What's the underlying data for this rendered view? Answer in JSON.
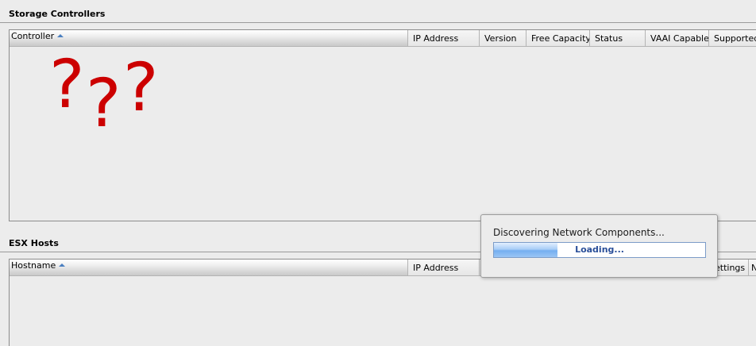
{
  "storage_controllers": {
    "title": "Storage Controllers",
    "columns": [
      {
        "label": "Controller",
        "sorted": true
      },
      {
        "label": "IP Address"
      },
      {
        "label": "Version"
      },
      {
        "label": "Free Capacity"
      },
      {
        "label": "Status"
      },
      {
        "label": "VAAI Capable"
      },
      {
        "label": "Supported"
      }
    ]
  },
  "esx_hosts": {
    "title": "ESX Hosts",
    "columns": [
      {
        "label": "Hostname",
        "sorted": true
      },
      {
        "label": "IP Address"
      },
      {
        "label": "ettings"
      },
      {
        "label": "N"
      }
    ]
  },
  "annotation": {
    "marks": [
      "?",
      "?",
      "?"
    ],
    "color": "#cc0000"
  },
  "loading_dialog": {
    "message": "Discovering Network Components...",
    "progress_label": "Loading...",
    "progress_fraction": 0.3
  }
}
